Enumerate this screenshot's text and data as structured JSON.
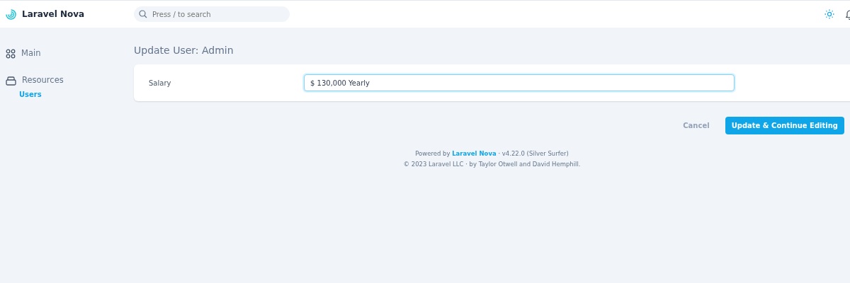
{
  "brand": {
    "name": "Laravel Nova"
  },
  "search": {
    "placeholder": "Press / to search"
  },
  "sidebar": {
    "items": [
      {
        "label": "Main"
      },
      {
        "label": "Resources",
        "children": [
          {
            "label": "Users",
            "selected": true
          }
        ]
      }
    ]
  },
  "page_title": "Update User: Admin",
  "form": {
    "fields": [
      {
        "label": "Salary",
        "value": "$ 130,000 Yearly",
        "focused": true
      }
    ]
  },
  "actions": {
    "cancel": "Cancel",
    "submit": "Update & Continue Editing"
  },
  "footer": {
    "prefix": "Powered by",
    "link": "Laravel Nova",
    "suffix": "· v4.22.0 (Silver Surfer)",
    "copyright": "© 2023 Laravel LLC · by Taylor Otwell and David Hemphill."
  }
}
